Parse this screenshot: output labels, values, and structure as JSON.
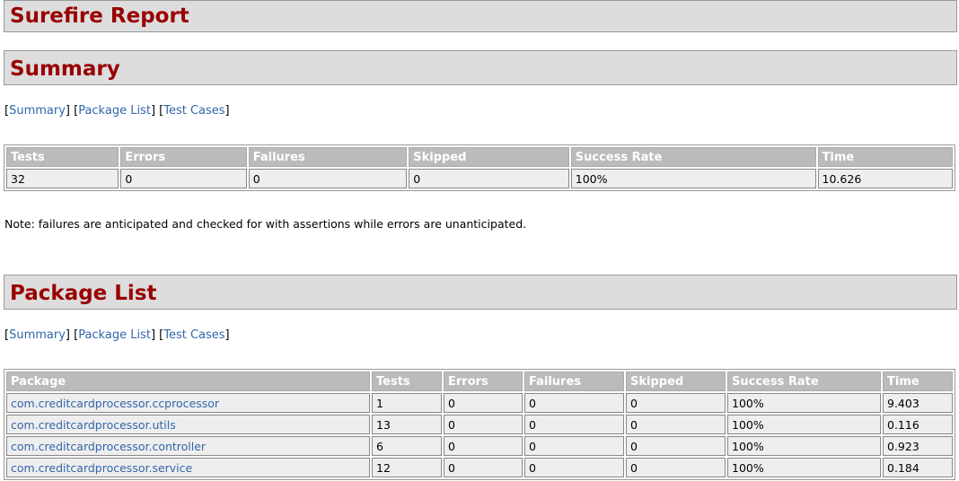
{
  "report": {
    "title": "Surefire Report"
  },
  "summary_section": {
    "title": "Summary"
  },
  "package_section": {
    "title": "Package List"
  },
  "nav": {
    "summary": "Summary",
    "package_list": "Package List",
    "test_cases": "Test Cases"
  },
  "summary_table": {
    "headers": [
      "Tests",
      "Errors",
      "Failures",
      "Skipped",
      "Success Rate",
      "Time"
    ],
    "row": [
      "32",
      "0",
      "0",
      "0",
      "100%",
      "10.626"
    ]
  },
  "note": "Note: failures are anticipated and checked for with assertions while errors are unanticipated.",
  "package_table": {
    "headers": [
      "Package",
      "Tests",
      "Errors",
      "Failures",
      "Skipped",
      "Success Rate",
      "Time"
    ],
    "rows": [
      [
        "com.creditcardprocessor.ccprocessor",
        "1",
        "0",
        "0",
        "0",
        "100%",
        "9.403"
      ],
      [
        "com.creditcardprocessor.utils",
        "13",
        "0",
        "0",
        "0",
        "100%",
        "0.116"
      ],
      [
        "com.creditcardprocessor.controller",
        "6",
        "0",
        "0",
        "0",
        "100%",
        "0.923"
      ],
      [
        "com.creditcardprocessor.service",
        "12",
        "0",
        "0",
        "0",
        "100%",
        "0.184"
      ]
    ]
  }
}
